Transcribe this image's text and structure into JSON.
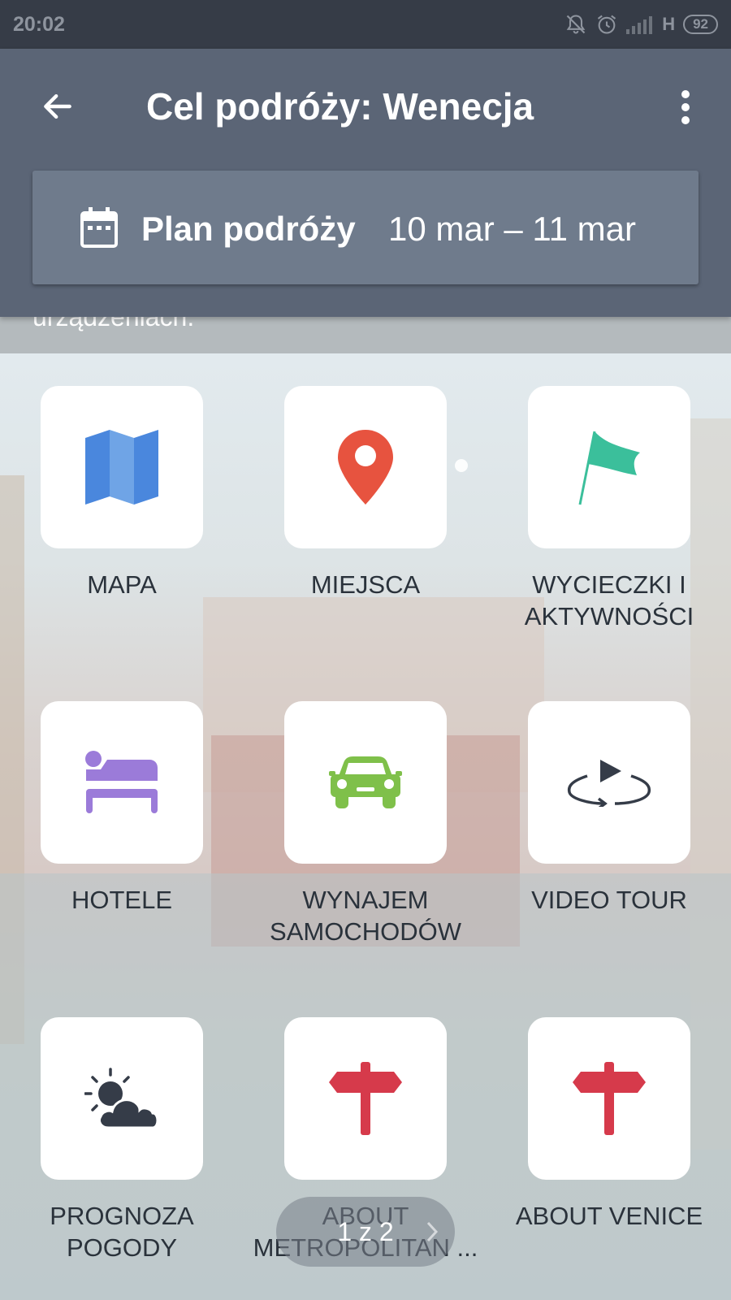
{
  "status_bar": {
    "time": "20:02",
    "network": "H",
    "battery": "92"
  },
  "header": {
    "title": "Cel podróży: Wenecja",
    "back_icon": "arrow-left-icon",
    "menu_icon": "more-vert-icon"
  },
  "plan": {
    "title": "Plan podróży",
    "dates": "10 mar – 11 mar",
    "icon": "calendar-icon"
  },
  "behind_text": "urządzeniach.",
  "tiles": [
    {
      "label": "MAPA",
      "icon": "map-icon",
      "color": "#4a87dd"
    },
    {
      "label": "MIEJSCA",
      "icon": "location-pin-icon",
      "color": "#e7533f"
    },
    {
      "label": "WYCIECZKI I AKTYWNOŚCI",
      "icon": "flag-icon",
      "color": "#3bbf9b"
    },
    {
      "label": "HOTELE",
      "icon": "bed-icon",
      "color": "#9b7bd9"
    },
    {
      "label": "WYNAJEM SAMOCHODÓW",
      "icon": "car-icon",
      "color": "#7fc04a"
    },
    {
      "label": "VIDEO TOUR",
      "icon": "video-360-icon",
      "color": "#353c48"
    },
    {
      "label": "PROGNOZA POGODY",
      "icon": "weather-icon",
      "color": "#353c48"
    },
    {
      "label": "ABOUT METROPOLITAN ...",
      "icon": "signpost-icon",
      "color": "#d63a4b"
    },
    {
      "label": "ABOUT VENICE",
      "icon": "signpost-icon",
      "color": "#d63a4b"
    }
  ],
  "pager": {
    "text": "1 z 2"
  }
}
